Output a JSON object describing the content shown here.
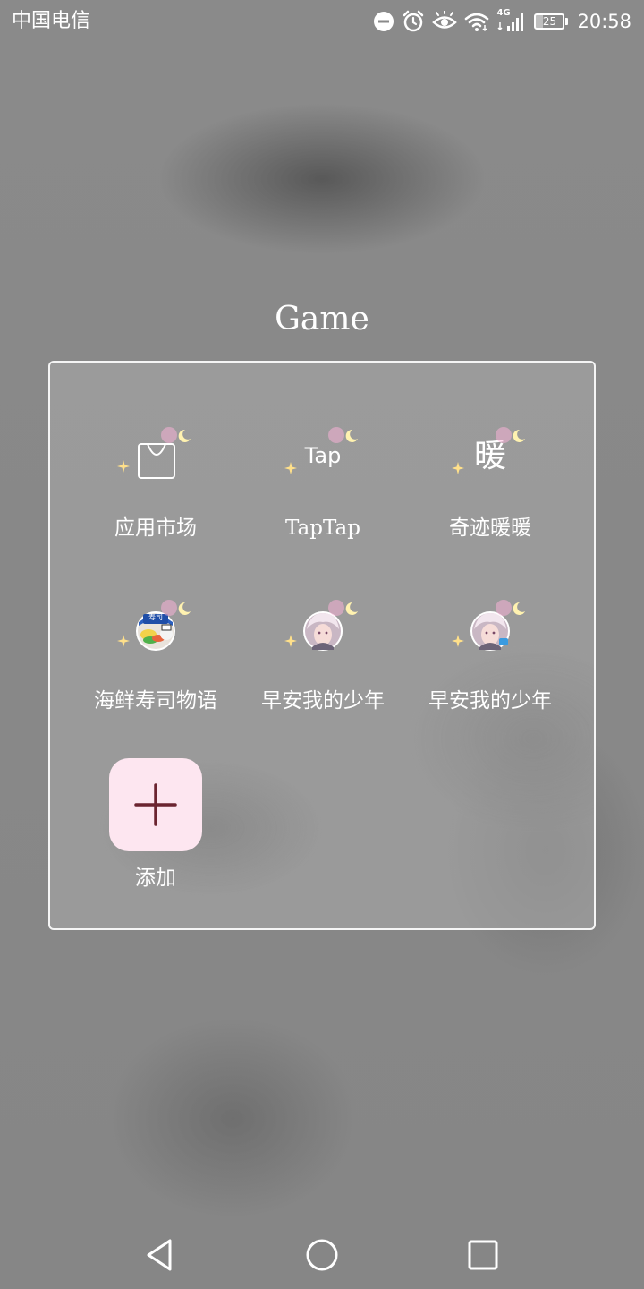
{
  "status_bar": {
    "carrier": "中国电信",
    "network": "4G",
    "battery_level": "25",
    "battery_fraction": 0.25,
    "time": "20:58",
    "icons": [
      "do-not-disturb-icon",
      "alarm-icon",
      "eye-comfort-icon",
      "wifi-icon",
      "signal-icon",
      "battery-icon"
    ]
  },
  "folder": {
    "title": "Game",
    "apps": [
      {
        "label": "应用市场",
        "icon": "app-market-bag-icon",
        "icon_text": ""
      },
      {
        "label": "TapTap",
        "icon": "taptap-icon",
        "icon_text": "Tap"
      },
      {
        "label": "奇迹暖暖",
        "icon": "nikki-icon",
        "icon_text": "暖"
      },
      {
        "label": "海鲜寿司物语",
        "icon": "sushi-game-icon",
        "icon_text": "寿司"
      },
      {
        "label": "早安我的少年",
        "icon": "good-morning-boy-icon",
        "icon_text": ""
      },
      {
        "label": "早安我的少年",
        "icon": "good-morning-boy-icon",
        "icon_text": ""
      }
    ],
    "add_label": "添加",
    "add_icon": "plus-icon"
  },
  "nav_bar": {
    "buttons": [
      "back-icon",
      "home-icon",
      "recents-icon"
    ]
  },
  "colors": {
    "accent_pink": "#fde6f0",
    "plus_color": "#6b2430",
    "text": "#ffffff"
  }
}
